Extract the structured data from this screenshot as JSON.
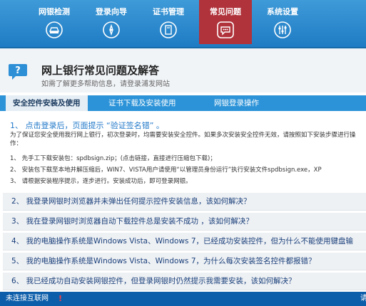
{
  "nav": {
    "items": [
      {
        "label": "网银检测"
      },
      {
        "label": "登录向导"
      },
      {
        "label": "证书管理"
      },
      {
        "label": "常见问题"
      },
      {
        "label": "系统设置"
      }
    ],
    "active_index": 3,
    "active_color": "#b0323a",
    "bar_color": "#2a88cf"
  },
  "header": {
    "title": "网上银行常见问题及解答",
    "subtitle": "如需了解更多帮助信息，请登录浦发网站"
  },
  "tabs": [
    {
      "label": "安全控件安装及使用",
      "active": true
    },
    {
      "label": "证书下载及安装使用",
      "active": false
    },
    {
      "label": "网银登录操作",
      "active": false
    }
  ],
  "faq_open": {
    "question": "1、 点击登录后，页面提示 “验证签名错” 。",
    "intro": "为了保证您安全使用我行网上银行，初次登录时，均需要安装安全控件。如果多次安装安全控件无效，请按照如下安装步骤进行操作：",
    "steps": [
      "1、 先手工下载安装包：spdbsign.zip；(点击链接，直接进行压缩包下载)；",
      "2、 安装包下载至本地并解压缩后，WIN7、VISTA用户请使用“以管理员身份运行”执行安装文件spdbsign.exe，XP",
      "3、 请根据安装程序提示，逐步进行。安装成功后，即可登录网银。"
    ]
  },
  "faq_list": [
    "2、 我登录网银时浏览器并未弹出任何提示控件安装信息，该如何解决？",
    "3、 我在登录网银时浏览器自动下载控件总是安装不成功 ，该如何解决？",
    "4、 我的电脑操作系统是Windows Vista、Windows 7，已经成功安装控件，但为什么不能使用键盘输",
    "5、 我的电脑操作系统是Windows Vista、Windows 7，为什么每次安装签名控件都报错？",
    "6、 我已经成功自动安装网银控件，但登录网银时仍然提示我需要安装，该如何解决？"
  ],
  "status": {
    "text": "未连接互联网",
    "alert": "!",
    "right": "请"
  }
}
